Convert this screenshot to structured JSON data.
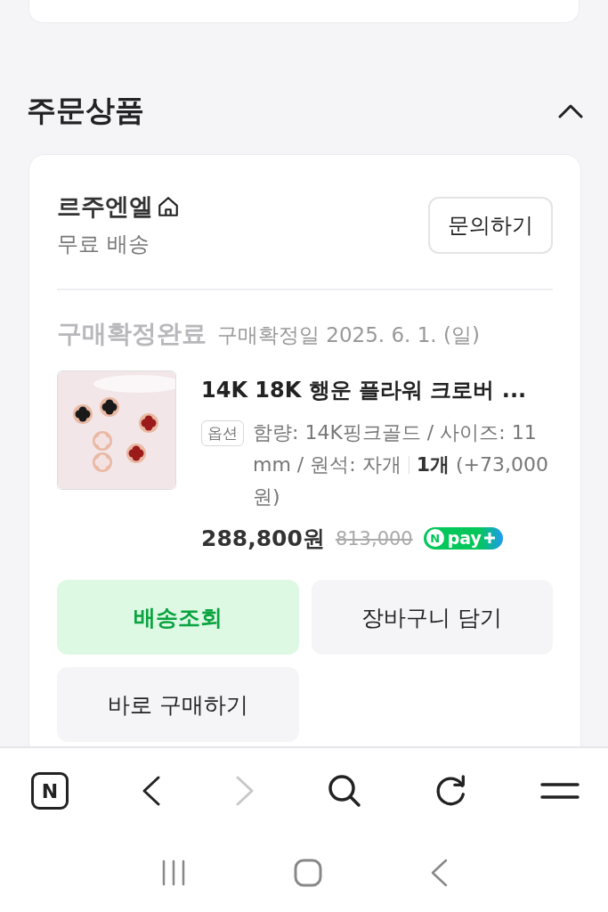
{
  "section": {
    "title": "주문상품",
    "expanded": true
  },
  "seller": {
    "name": "르주엔엘",
    "shipping": "무료 배송",
    "inquiry_button": "문의하기"
  },
  "order": {
    "status": "구매확정완료",
    "confirm_date": "구매확정일 2025. 6. 1. (일)"
  },
  "product": {
    "kind": "picture",
    "title": "14K 18K 행운 플라워 크로버 ...",
    "option_badge": "옵션",
    "option": "함량: 14K핑크골드 / 사이즈: 11mm / 원석: 자개",
    "quantity": "**1개** (+73,000원)",
    "price": "288,800원",
    "original_price": "813,000",
    "npay": {
      "mark": "N",
      "text": "pay"
    }
  },
  "buttons": [
    {
      "label": "배송조회",
      "kind": "primary"
    },
    {
      "label": "장바구니 담기",
      "kind": "secondary"
    },
    {
      "label": "바로 구매하기",
      "kind": "secondary"
    }
  ],
  "browser_bar": {
    "logo": "N",
    "forward_disabled": true
  }
}
